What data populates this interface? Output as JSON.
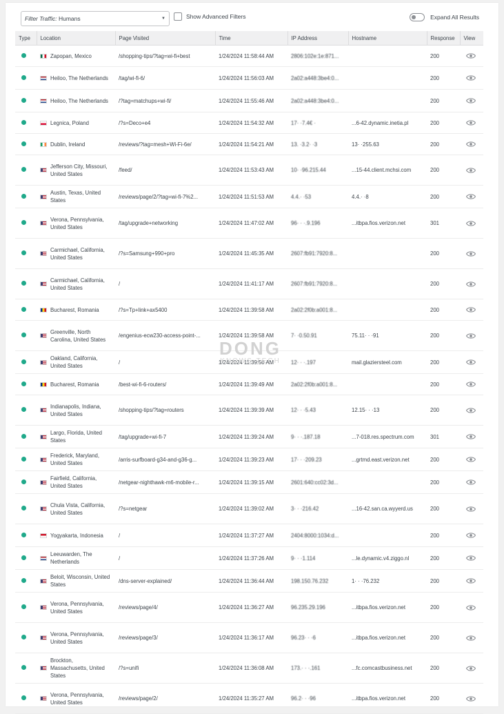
{
  "filters": {
    "traffic_label": "Filter Traffic:",
    "traffic_value": "Humans",
    "advanced_label": "Show Advanced Filters",
    "expand_label": "Expand All Results"
  },
  "columns": [
    "Type",
    "Location",
    "Page Visited",
    "Time",
    "IP Address",
    "Hostname",
    "Response",
    "View"
  ],
  "status_color": "#1fa98a",
  "rows": [
    {
      "h": "s",
      "flag": "mx",
      "location": "Zapopan, Mexico",
      "page": "/shopping-tips/?tag=wi-fi+best",
      "time": "1/24/2024 11:58:44 AM",
      "ip": "2806:102e:1e:871...",
      "hostname": "",
      "response": "200"
    },
    {
      "h": "m",
      "flag": "nl",
      "location": "Heiloo, The Netherlands",
      "page": "/tag/wi-fi-6/",
      "time": "1/24/2024 11:56:03 AM",
      "ip": "2a02:a448:3be4:0...",
      "hostname": "",
      "response": "200"
    },
    {
      "h": "m",
      "flag": "nl",
      "location": "Heiloo, The Netherlands",
      "page": "/?tag=matchups+wi-fi/",
      "time": "1/24/2024 11:55:46 AM",
      "ip": "2a02:a448:3be4:0...",
      "hostname": "",
      "response": "200"
    },
    {
      "h": "s",
      "flag": "pl",
      "location": "Legnica, Poland",
      "page": "/?s=Deco+e4",
      "time": "1/24/2024 11:54:32 AM",
      "ip": "17· ·7.4€ ·",
      "hostname": "...6-42.dynamic.inetia.pl",
      "response": "200"
    },
    {
      "h": "s",
      "flag": "ie",
      "location": "Dublin, Ireland",
      "page": "/reviews/?tag=mesh+Wi-Fi-6e/",
      "time": "1/24/2024 11:54:21 AM",
      "ip": "13. ·3.2· ·3",
      "hostname": "13· ·255.63",
      "response": "200"
    },
    {
      "h": "t",
      "flag": "us",
      "location": "Jefferson City, Missouri, United States",
      "page": "/feed/",
      "time": "1/24/2024 11:53:43 AM",
      "ip": "10· ·96.215.44",
      "hostname": "...15-44.client.mchsi.com",
      "response": "200"
    },
    {
      "h": "m",
      "flag": "us",
      "location": "Austin, Texas, United States",
      "page": "/reviews/page/2/?tag=wi-fi-7%2...",
      "time": "1/24/2024 11:51:53 AM",
      "ip": "4.4.· ·53",
      "hostname": "4.4.· ·8",
      "response": "200"
    },
    {
      "h": "t",
      "flag": "us",
      "location": "Verona, Pennsylvania, United States",
      "page": "/tag/upgrade+networking",
      "time": "1/24/2024 11:47:02 AM",
      "ip": "96· · ·.9.196",
      "hostname": "...itbpa.fios.verizon.net",
      "response": "301"
    },
    {
      "h": "t",
      "flag": "us",
      "location": "Carmichael, California, United States",
      "page": "/?s=Samsung+990+pro",
      "time": "1/24/2024 11:45:35 AM",
      "ip": "2607:fb91:7920:8...",
      "hostname": "",
      "response": "200"
    },
    {
      "h": "t",
      "flag": "us",
      "location": "Carmichael, California, United States",
      "page": "/",
      "time": "1/24/2024 11:41:17 AM",
      "ip": "2607:fb91:7920:8...",
      "hostname": "",
      "response": "200"
    },
    {
      "h": "s",
      "flag": "ro",
      "location": "Bucharest, Romania",
      "page": "/?s=Tp+link+ax5400",
      "time": "1/24/2024 11:39:58 AM",
      "ip": "2a02:2f0b:a001:8...",
      "hostname": "",
      "response": "200"
    },
    {
      "h": "t",
      "flag": "us",
      "location": "Greenville, North Carolina, United States",
      "page": "/engenius-ecw230-access-point-...",
      "time": "1/24/2024 11:39:58 AM",
      "ip": "7· ·0.50.91",
      "hostname": "75.11· · ·91",
      "response": "200"
    },
    {
      "h": "m",
      "flag": "us",
      "location": "Oakland, California, United States",
      "page": "/",
      "time": "1/24/2024 11:39:50 AM",
      "ip": "12· · ·.197",
      "hostname": "mail.glaziersteel.com",
      "response": "200"
    },
    {
      "h": "s",
      "flag": "ro",
      "location": "Bucharest, Romania",
      "page": "/best-wi-fi-6-routers/",
      "time": "1/24/2024 11:39:49 AM",
      "ip": "2a02:2f0b:a001:8...",
      "hostname": "",
      "response": "200"
    },
    {
      "h": "t",
      "flag": "us",
      "location": "Indianapolis, Indiana, United States",
      "page": "/shopping-tips/?tag=routers",
      "time": "1/24/2024 11:39:39 AM",
      "ip": "12· · ·5.43",
      "hostname": "12.15· · ·13",
      "response": "200"
    },
    {
      "h": "m",
      "flag": "us",
      "location": "Largo, Florida, United States",
      "page": "/tag/upgrade+wi-fi-7",
      "time": "1/24/2024 11:39:24 AM",
      "ip": "9· · ·.187.18",
      "hostname": "...7-018.res.spectrum.com",
      "response": "301"
    },
    {
      "h": "m",
      "flag": "us",
      "location": "Frederick, Maryland, United States",
      "page": "/arris-surfboard-g34-and-g36-g...",
      "time": "1/24/2024 11:39:23 AM",
      "ip": "17· · ·209.23",
      "hostname": "...grtmd.east.verizon.net",
      "response": "200"
    },
    {
      "h": "m",
      "flag": "us",
      "location": "Fairfield, California, United States",
      "page": "/netgear-nighthawk-m6-mobile-r...",
      "time": "1/24/2024 11:39:15 AM",
      "ip": "2601:640:cc02:3d...",
      "hostname": "",
      "response": "200"
    },
    {
      "h": "t",
      "flag": "us",
      "location": "Chula Vista, California, United States",
      "page": "/?s=netgear",
      "time": "1/24/2024 11:39:02 AM",
      "ip": "3· · ·216.42",
      "hostname": "...16-42.san.ca.wyyerd.us",
      "response": "200"
    },
    {
      "h": "m",
      "flag": "id",
      "location": "Yogyakarta, Indonesia",
      "page": "/",
      "time": "1/24/2024 11:37:27 AM",
      "ip": "2404:8000:1034:d...",
      "hostname": "",
      "response": "200"
    },
    {
      "h": "m",
      "flag": "nl",
      "location": "Leeuwarden, The Netherlands",
      "page": "/",
      "time": "1/24/2024 11:37:26 AM",
      "ip": "9· · ·1.114",
      "hostname": "...le.dynamic.v4.ziggo.nl",
      "response": "200"
    },
    {
      "h": "m",
      "flag": "us",
      "location": "Beloit, Wisconsin, United States",
      "page": "/dns-server-explained/",
      "time": "1/24/2024 11:36:44 AM",
      "ip": "198.150.76.232",
      "hostname": "1· · ·76.232",
      "response": "200"
    },
    {
      "h": "t",
      "flag": "us",
      "location": "Verona, Pennsylvania, United States",
      "page": "/reviews/page/4/",
      "time": "1/24/2024 11:36:27 AM",
      "ip": "96.235.29.196",
      "hostname": "...itbpa.fios.verizon.net",
      "response": "200"
    },
    {
      "h": "t",
      "flag": "us",
      "location": "Verona, Pennsylvania, United States",
      "page": "/reviews/page/3/",
      "time": "1/24/2024 11:36:17 AM",
      "ip": "96.23· · ·6",
      "hostname": "...itbpa.fios.verizon.net",
      "response": "200"
    },
    {
      "h": "t",
      "flag": "us",
      "location": "Brockton, Massachusetts, United States",
      "page": "/?s=unifi",
      "time": "1/24/2024 11:36:08 AM",
      "ip": "173.· · ·.161",
      "hostname": "...fc.comcastbusiness.net",
      "response": "200"
    },
    {
      "h": "t",
      "flag": "us",
      "location": "Verona, Pennsylvania, United States",
      "page": "/reviews/page/2/",
      "time": "1/24/2024 11:35:27 AM",
      "ip": "96.2· · ·96",
      "hostname": "...itbpa.fios.verizon.net",
      "response": "200"
    }
  ],
  "watermark": {
    "line1": "DONG",
    "line2": "KNOWS TECH"
  }
}
